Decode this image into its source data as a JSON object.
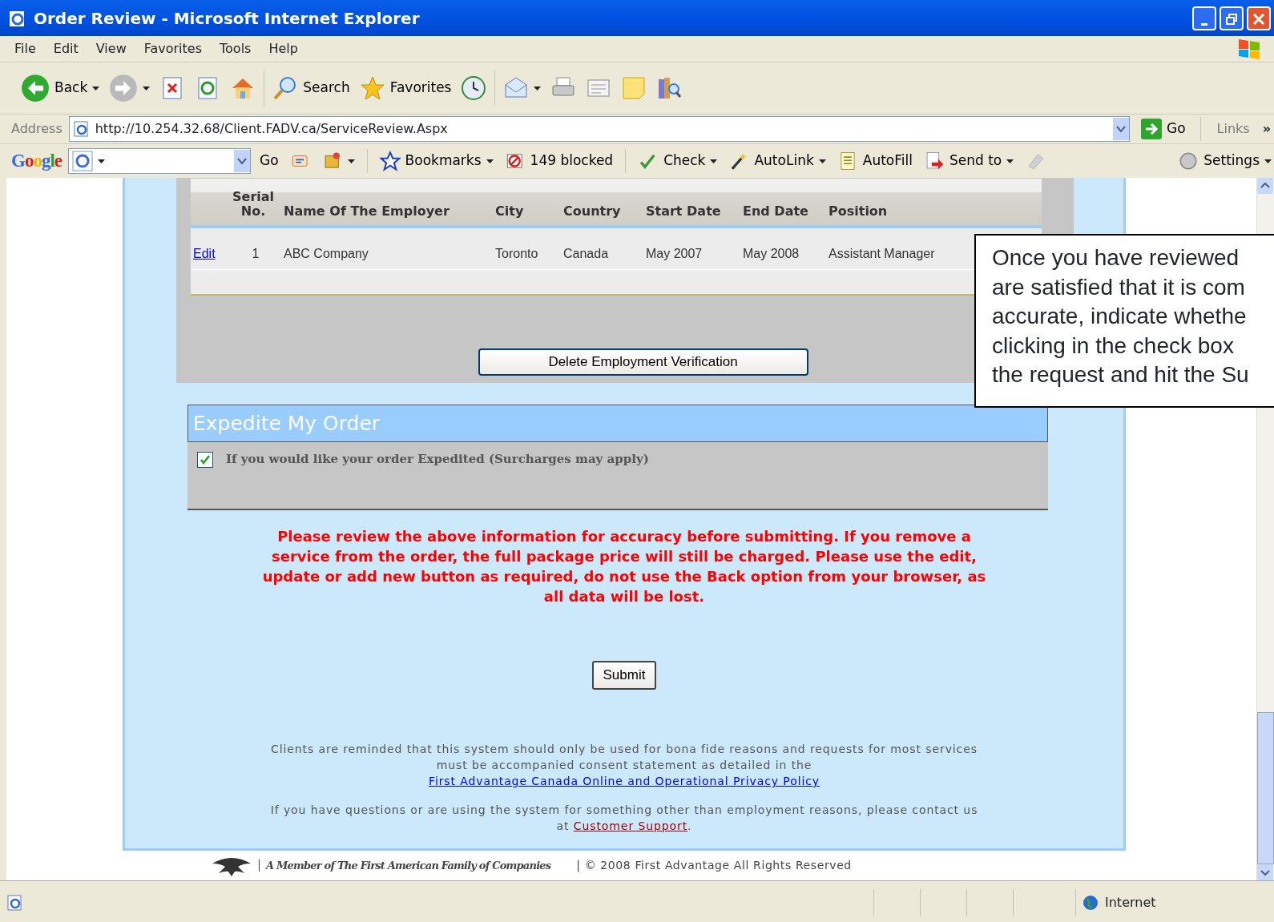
{
  "window": {
    "title": "Order Review - Microsoft Internet Explorer"
  },
  "menu": [
    "File",
    "Edit",
    "View",
    "Favorites",
    "Tools",
    "Help"
  ],
  "toolbar": [
    {
      "kind": "back",
      "label": "Back",
      "dropdown": true
    },
    {
      "kind": "forward",
      "dropdown": true
    },
    {
      "kind": "stop"
    },
    {
      "kind": "refresh"
    },
    {
      "kind": "home"
    },
    {
      "kind": "search",
      "label": "Search"
    },
    {
      "kind": "favorites",
      "label": "Favorites"
    },
    {
      "kind": "history"
    },
    {
      "kind": "mail",
      "dropdown": true
    },
    {
      "kind": "print"
    },
    {
      "kind": "edit"
    },
    {
      "kind": "note"
    },
    {
      "kind": "research"
    }
  ],
  "address_bar": {
    "label": "Address",
    "url": "http://10.254.32.68/Client.FADV.ca/ServiceReview.Aspx",
    "go": "Go",
    "links": "Links",
    "more": "»"
  },
  "google_logo": "Google",
  "google_bar": [
    {
      "kind": "go",
      "label": "Go"
    },
    {
      "kind": "popup"
    },
    {
      "kind": "tools",
      "dropdown": true
    },
    {
      "kind": "bookmarks",
      "label": "Bookmarks",
      "dropdown": true
    },
    {
      "kind": "blocked",
      "label": "149 blocked"
    },
    {
      "kind": "check",
      "label": "Check",
      "dropdown": true
    },
    {
      "kind": "autolink",
      "label": "AutoLink",
      "dropdown": true
    },
    {
      "kind": "autofill",
      "label": "AutoFill"
    },
    {
      "kind": "sendto",
      "label": "Send to",
      "dropdown": true
    },
    {
      "kind": "eraser"
    },
    {
      "kind": "settings",
      "label": "Settings",
      "dropdown": true
    }
  ],
  "employment_table": {
    "columns": [
      "Serial No.",
      "Name Of The Employer",
      "City",
      "Country",
      "Start Date",
      "End Date",
      "Position"
    ],
    "rows": [
      {
        "action": "Edit",
        "cells": [
          "1",
          "ABC Company",
          "Toronto",
          "Canada",
          "May 2007",
          "May 2008",
          "Assistant Manager"
        ]
      }
    ]
  },
  "delete_button": "Delete Employment Verification",
  "expedite": {
    "title": "Expedite My Order",
    "option": {
      "label": "If you would like your order Expedited (Surcharges may apply)",
      "checked": true
    }
  },
  "warning": "Please review the above information for accuracy before submitting. If you remove a service from the order, the full package price will still be charged. Please use the edit, update or add new button as required, do not use the Back option from your browser, as all data will be lost.",
  "submit_button": "Submit",
  "notices": [
    {
      "text": "Clients are reminded that this system should only be used for bona fide reasons and requests for most services must be accompanied consent statement as detailed in the",
      "link": "First Advantage Canada Online and Operational Privacy Policy"
    },
    {
      "text": "If you have questions or are using the system for something other than employment reasons, please contact us at",
      "link": "Customer Support",
      "after": "."
    }
  ],
  "footer": {
    "member": "A Member of The First American Family of Companies",
    "copyright": "| © 2008 First Advantage All Rights Reserved"
  },
  "callout": [
    "Once you have reviewed",
    "are satisfied that it is com",
    "accurate, indicate whethe",
    "clicking in the check box",
    "the request and hit the Su"
  ],
  "status_bar": {
    "zone": "Internet"
  }
}
